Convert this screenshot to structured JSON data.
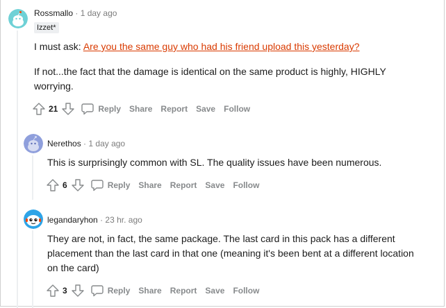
{
  "comments": [
    {
      "author": "Rossmallo",
      "separator": "·",
      "time": "1 day ago",
      "flair": "Izzet*",
      "body_prefix": "I must ask: ",
      "link_text": "Are you the same guy who had his friend upload this yesterday?",
      "body_line2": "If not...the fact that the damage is identical on the same product is highly, HIGHLY worrying.",
      "score": "21",
      "actions": {
        "reply": "Reply",
        "share": "Share",
        "report": "Report",
        "save": "Save",
        "follow": "Follow"
      }
    },
    {
      "author": "Nerethos",
      "separator": "·",
      "time": "1 day ago",
      "body": "This is surprisingly common with SL. The quality issues have been numerous.",
      "score": "6",
      "actions": {
        "reply": "Reply",
        "share": "Share",
        "report": "Report",
        "save": "Save",
        "follow": "Follow"
      }
    },
    {
      "author": "legandaryhon",
      "separator": "·",
      "time": "23 hr. ago",
      "body": "They are not, in fact, the same package. The last card in this pack has a different placement than the last card in that one (meaning it's been bent at a different location on the card)",
      "score": "3",
      "actions": {
        "reply": "Reply",
        "share": "Share",
        "report": "Report",
        "save": "Save",
        "follow": "Follow"
      }
    }
  ],
  "icons": {
    "upvote": "upvote-arrow-icon",
    "downvote": "downvote-arrow-icon",
    "reply": "comment-bubble-icon",
    "avatar": "snoo-avatar-icon"
  },
  "colors": {
    "link": "#d93a00",
    "meta": "#7c7c7c",
    "action": "#878a8c",
    "thread_line": "#edeff1",
    "avatar_teal": "#6fd1d6",
    "avatar_lavender": "#8f9fdc",
    "avatar_blue": "#2fa4e7"
  }
}
